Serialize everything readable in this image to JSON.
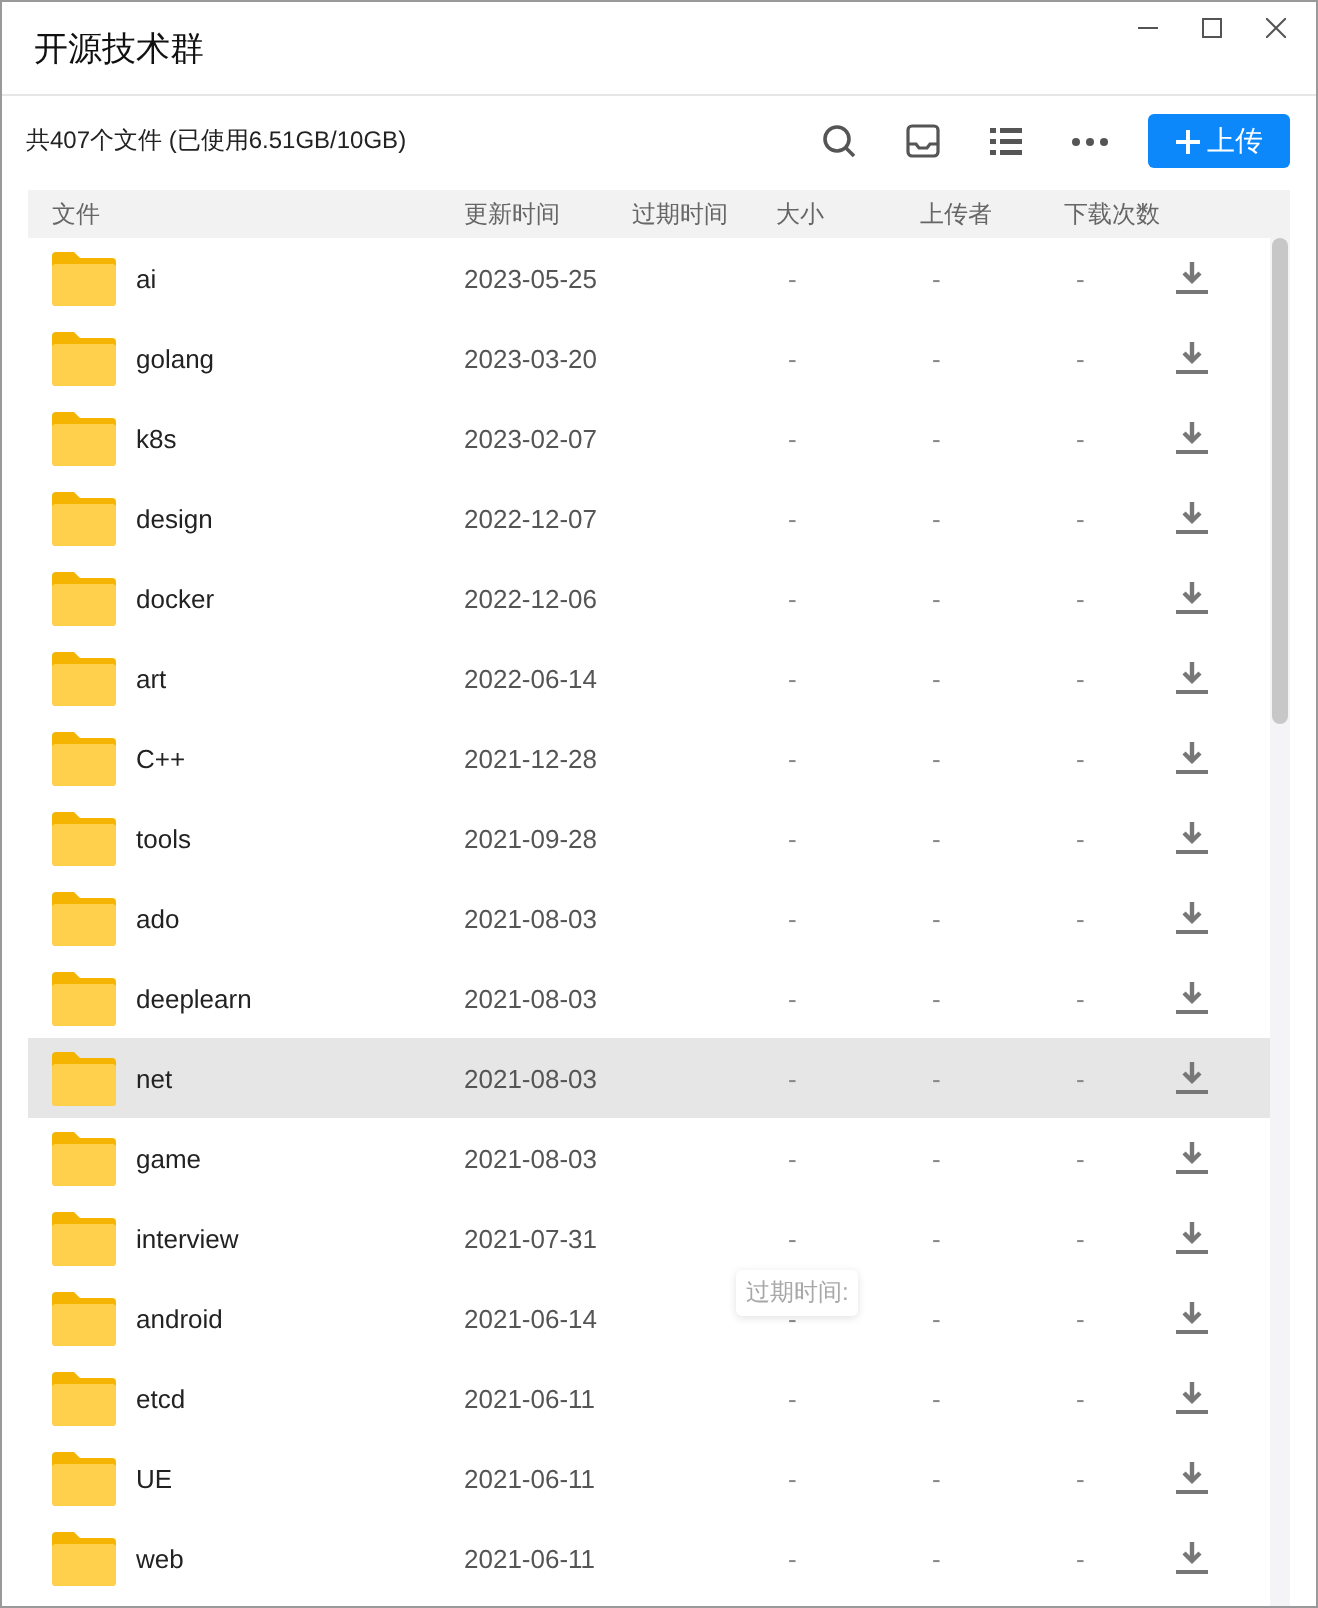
{
  "window": {
    "title": "开源技术群"
  },
  "toolbar": {
    "summary": "共407个文件 (已使用6.51GB/10GB)",
    "upload_button": "上传"
  },
  "table": {
    "columns": [
      "文件",
      "更新时间",
      "过期时间",
      "大小",
      "上传者",
      "下载次数"
    ],
    "rows": [
      {
        "name": "ai",
        "updated": "2023-05-25",
        "size": "-",
        "uploader": "-",
        "downloads": "-",
        "selected": false
      },
      {
        "name": "golang",
        "updated": "2023-03-20",
        "size": "-",
        "uploader": "-",
        "downloads": "-",
        "selected": false
      },
      {
        "name": "k8s",
        "updated": "2023-02-07",
        "size": "-",
        "uploader": "-",
        "downloads": "-",
        "selected": false
      },
      {
        "name": "design",
        "updated": "2022-12-07",
        "size": "-",
        "uploader": "-",
        "downloads": "-",
        "selected": false
      },
      {
        "name": "docker",
        "updated": "2022-12-06",
        "size": "-",
        "uploader": "-",
        "downloads": "-",
        "selected": false
      },
      {
        "name": "art",
        "updated": "2022-06-14",
        "size": "-",
        "uploader": "-",
        "downloads": "-",
        "selected": false
      },
      {
        "name": "C++",
        "updated": "2021-12-28",
        "size": "-",
        "uploader": "-",
        "downloads": "-",
        "selected": false
      },
      {
        "name": "tools",
        "updated": "2021-09-28",
        "size": "-",
        "uploader": "-",
        "downloads": "-",
        "selected": false
      },
      {
        "name": "ado",
        "updated": "2021-08-03",
        "size": "-",
        "uploader": "-",
        "downloads": "-",
        "selected": false
      },
      {
        "name": "deeplearn",
        "updated": "2021-08-03",
        "size": "-",
        "uploader": "-",
        "downloads": "-",
        "selected": false
      },
      {
        "name": "net",
        "updated": "2021-08-03",
        "size": "-",
        "uploader": "-",
        "downloads": "-",
        "selected": true
      },
      {
        "name": "game",
        "updated": "2021-08-03",
        "size": "-",
        "uploader": "-",
        "downloads": "-",
        "selected": false
      },
      {
        "name": "interview",
        "updated": "2021-07-31",
        "size": "-",
        "uploader": "-",
        "downloads": "-",
        "selected": false
      },
      {
        "name": "android",
        "updated": "2021-06-14",
        "size": "-",
        "uploader": "-",
        "downloads": "-",
        "selected": false
      },
      {
        "name": "etcd",
        "updated": "2021-06-11",
        "size": "-",
        "uploader": "-",
        "downloads": "-",
        "selected": false
      },
      {
        "name": "UE",
        "updated": "2021-06-11",
        "size": "-",
        "uploader": "-",
        "downloads": "-",
        "selected": false
      },
      {
        "name": "web",
        "updated": "2021-06-11",
        "size": "-",
        "uploader": "-",
        "downloads": "-",
        "selected": false
      }
    ]
  },
  "tooltip": {
    "text": "过期时间:"
  }
}
